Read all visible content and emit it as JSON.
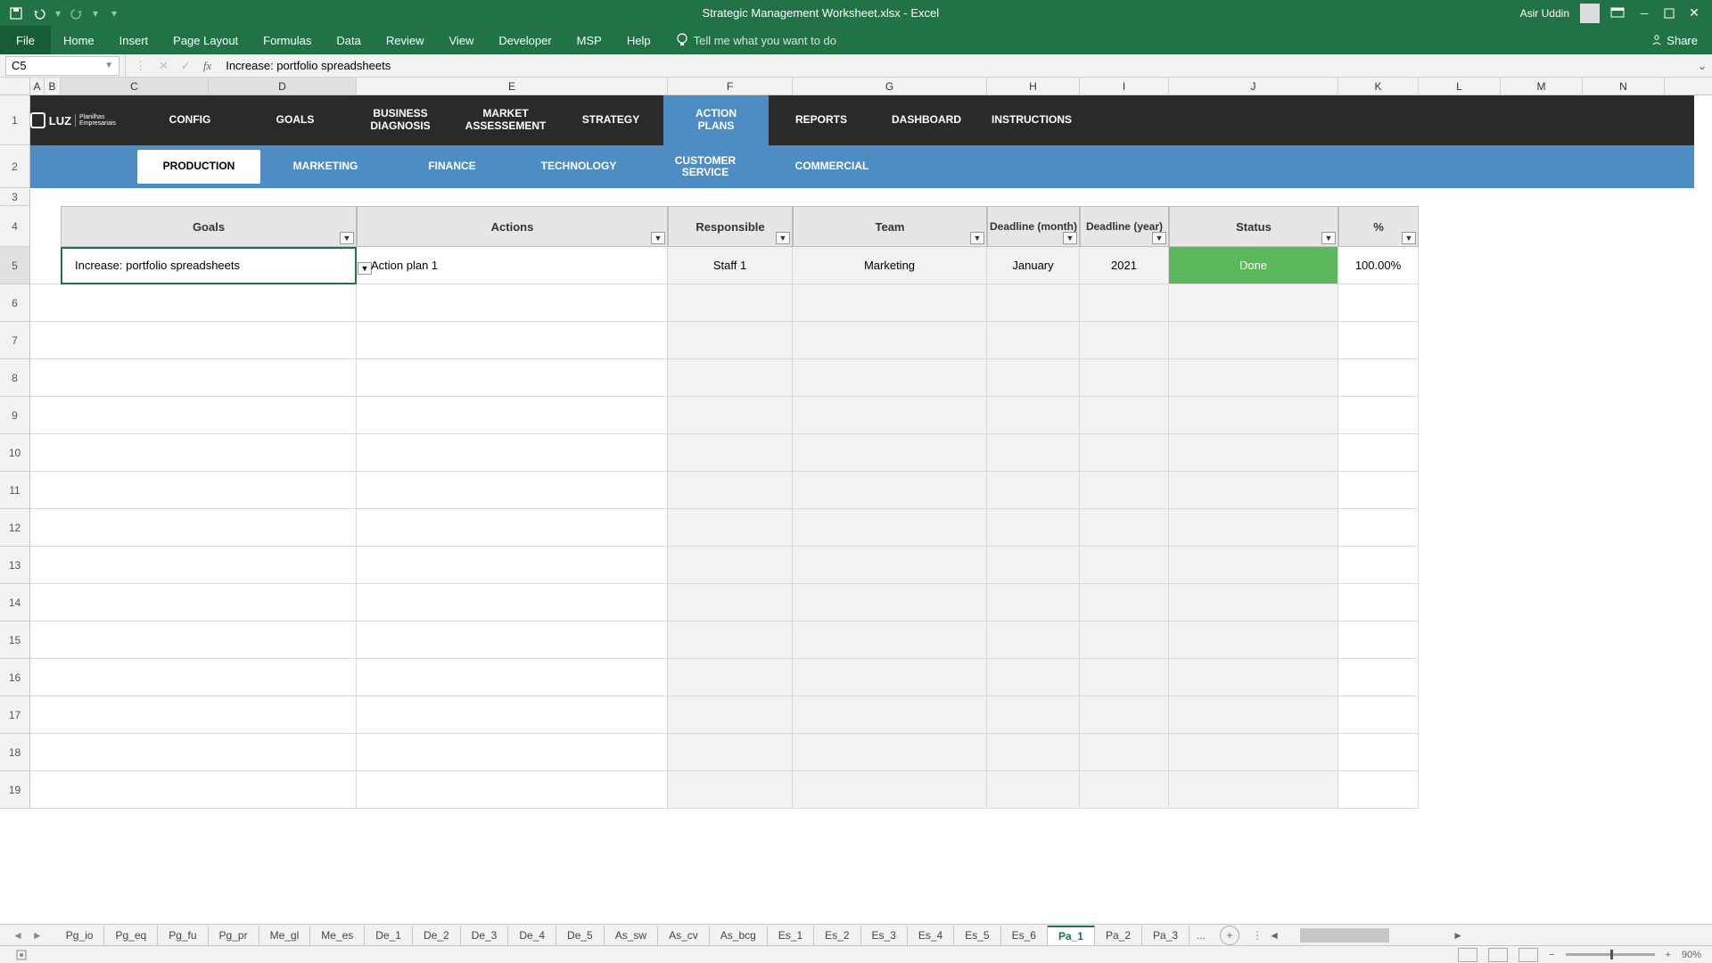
{
  "titlebar": {
    "filename": "Strategic Management Worksheet.xlsx  -  Excel",
    "user": "Asir Uddin"
  },
  "ribbon": {
    "file": "File",
    "tabs": [
      "Home",
      "Insert",
      "Page Layout",
      "Formulas",
      "Data",
      "Review",
      "View",
      "Developer",
      "MSP",
      "Help"
    ],
    "tell_me": "Tell me what you want to do",
    "share": "Share"
  },
  "formula": {
    "namebox": "C5",
    "value": "Increase: portfolio spreadsheets"
  },
  "col_letters": [
    "A",
    "B",
    "C",
    "D",
    "E",
    "F",
    "G",
    "H",
    "I",
    "J",
    "K",
    "L",
    "M",
    "N"
  ],
  "row_numbers": [
    "1",
    "2",
    "3",
    "4",
    "5",
    "6",
    "7",
    "8",
    "9",
    "10",
    "11",
    "12",
    "13",
    "14",
    "15",
    "16",
    "17",
    "18",
    "19"
  ],
  "logo_text": "LUZ",
  "logo_sub": "Planilhas Empresariais",
  "app_tabs": [
    "CONFIG",
    "GOALS",
    "BUSINESS DIAGNOSIS",
    "MARKET ASSESSEMENT",
    "STRATEGY",
    "ACTION PLANS",
    "REPORTS",
    "DASHBOARD",
    "INSTRUCTIONS"
  ],
  "app_active": "ACTION PLANS",
  "sub_tabs": [
    "PRODUCTION",
    "MARKETING",
    "FINANCE",
    "TECHNOLOGY",
    "CUSTOMER SERVICE",
    "COMMERCIAL"
  ],
  "sub_active": "PRODUCTION",
  "table": {
    "headers": {
      "goals": "Goals",
      "actions": "Actions",
      "responsible": "Responsible",
      "team": "Team",
      "deadline_m": "Deadline (month)",
      "deadline_y": "Deadline (year)",
      "status": "Status",
      "pct": "%"
    },
    "row": {
      "goals": "Increase: portfolio spreadsheets",
      "actions": "Action plan 1",
      "responsible": "Staff 1",
      "team": "Marketing",
      "deadline_m": "January",
      "deadline_y": "2021",
      "status": "Done",
      "pct": "100.00%"
    }
  },
  "sheet_tabs": [
    "Pg_io",
    "Pg_eq",
    "Pg_fu",
    "Pg_pr",
    "Me_gl",
    "Me_es",
    "De_1",
    "De_2",
    "De_3",
    "De_4",
    "De_5",
    "As_sw",
    "As_cv",
    "As_bcg",
    "Es_1",
    "Es_2",
    "Es_3",
    "Es_4",
    "Es_5",
    "Es_6",
    "Pa_1",
    "Pa_2",
    "Pa_3"
  ],
  "sheet_active": "Pa_1",
  "sheet_more": "...",
  "status": {
    "zoom": "90%"
  }
}
